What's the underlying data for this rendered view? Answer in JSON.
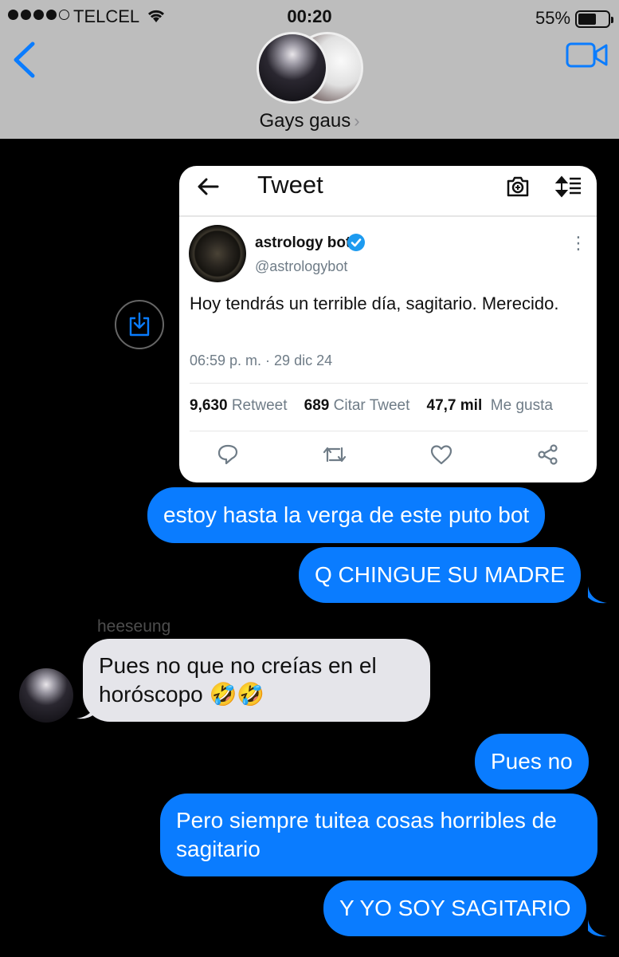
{
  "status_bar": {
    "carrier": "TELCEL",
    "time": "00:20",
    "battery": "55%"
  },
  "conversation": {
    "group_name": "Gays gaus"
  },
  "tweet_card": {
    "title": "Tweet",
    "author_name": "astrology bot",
    "handle": "@astrologybot",
    "text": "Hoy tendrás un terrible día, sagitario. Merecido.",
    "timestamp": "06:59 p. m. · 29 dic 24",
    "retweets_count": "9,630",
    "retweets_label": "Retweet",
    "quotes_count": "689",
    "quotes_label": "Citar Tweet",
    "likes_count": "47,7 mil",
    "likes_label": "Me gusta"
  },
  "messages": [
    {
      "text": "estoy hasta la verga de este puto bot"
    },
    {
      "text": "Q CHINGUE SU MADRE"
    },
    {
      "sender": "heeseung",
      "text": "Pues no que no creías en el horóscopo 🤣🤣"
    },
    {
      "text": "Pues no"
    },
    {
      "text": "Pero siempre tuitea cosas horribles de sagitario"
    },
    {
      "text": "Y YO SOY SAGITARIO"
    }
  ],
  "colors": {
    "header_bg": "#bdbdbd",
    "ios_blue": "#0a7cff",
    "incoming_bubble": "#e5e5ea",
    "twitter_blue": "#1d9bf0"
  }
}
